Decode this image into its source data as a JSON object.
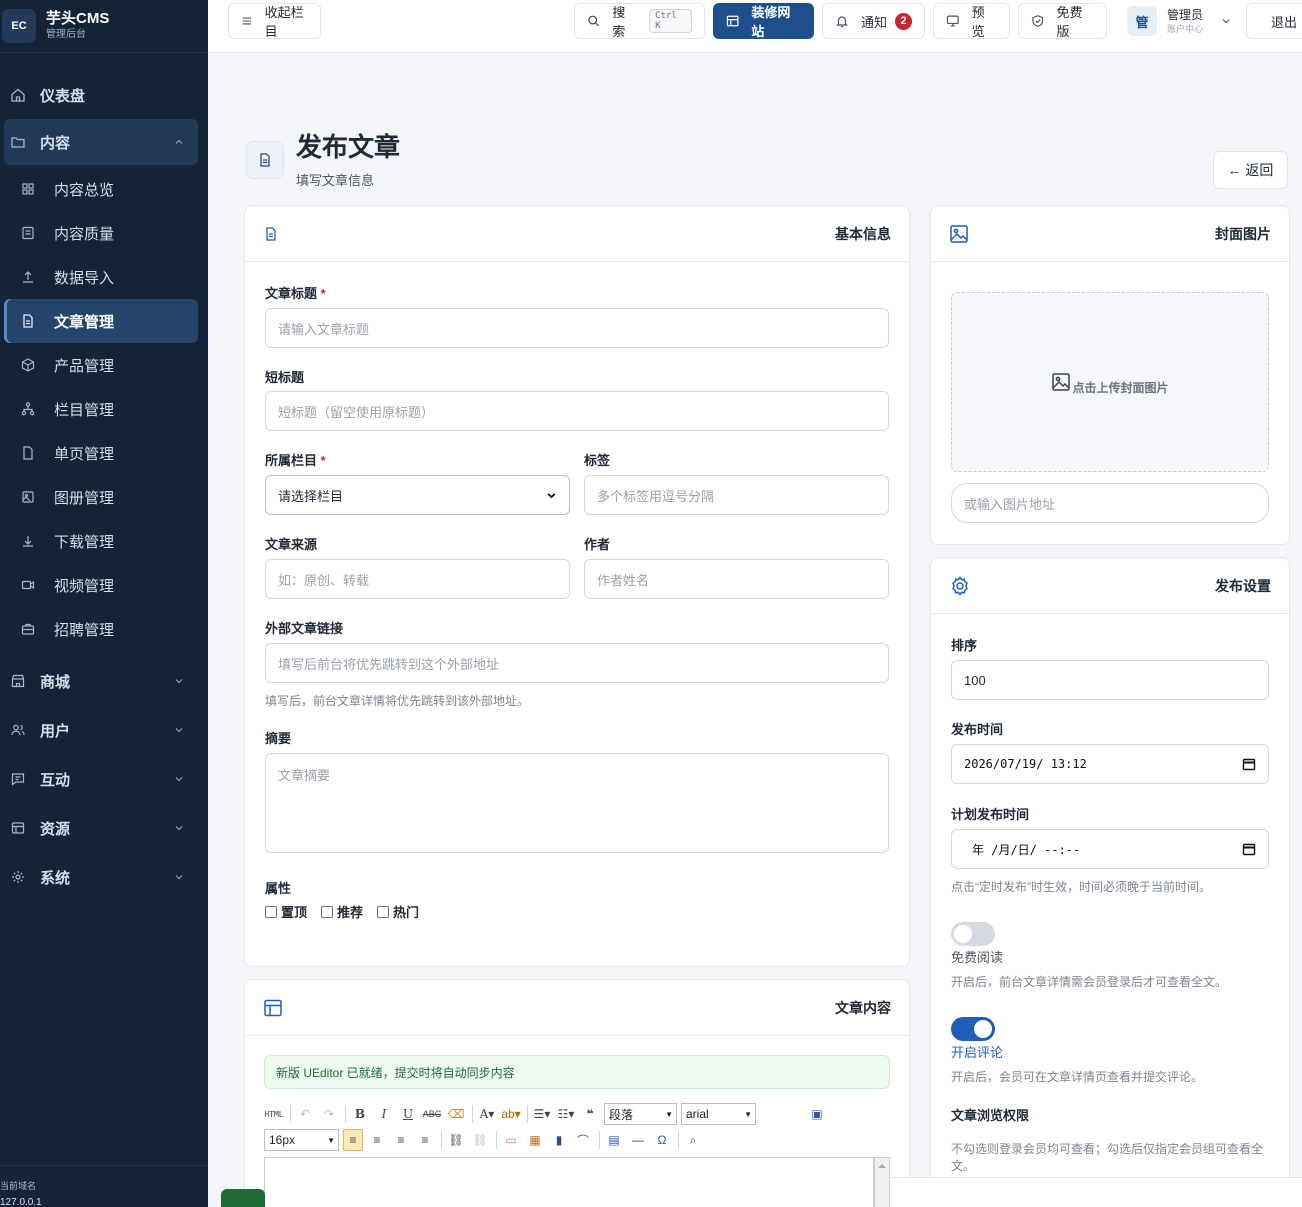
{
  "brand": {
    "logo": "EC",
    "name": "芋头CMS",
    "sub": "管理后台"
  },
  "sidebar": {
    "items": [
      {
        "label": "仪表盘",
        "icon": "home-icon"
      },
      {
        "label": "内容",
        "icon": "folder-icon"
      },
      {
        "label": "内容总览",
        "icon": "grid-icon"
      },
      {
        "label": "内容质量",
        "icon": "checklist-icon"
      },
      {
        "label": "数据导入",
        "icon": "upload-icon"
      },
      {
        "label": "文章管理",
        "icon": "document-icon"
      },
      {
        "label": "产品管理",
        "icon": "package-icon"
      },
      {
        "label": "栏目管理",
        "icon": "sitemap-icon"
      },
      {
        "label": "单页管理",
        "icon": "page-icon"
      },
      {
        "label": "图册管理",
        "icon": "album-icon"
      },
      {
        "label": "下载管理",
        "icon": "download-icon"
      },
      {
        "label": "视频管理",
        "icon": "video-icon"
      },
      {
        "label": "招聘管理",
        "icon": "briefcase-icon"
      },
      {
        "label": "商城",
        "icon": "store-icon"
      },
      {
        "label": "用户",
        "icon": "users-icon"
      },
      {
        "label": "互动",
        "icon": "chat-icon"
      },
      {
        "label": "资源",
        "icon": "layout-icon"
      },
      {
        "label": "系统",
        "icon": "settings-icon"
      }
    ],
    "footer_key": "当前域名",
    "footer_value": "127.0.0.1"
  },
  "topbar": {
    "collapse": "收起栏目",
    "search": "搜索",
    "search_kbd": "Ctrl K",
    "decorate": "装修网站",
    "notify": "通知",
    "notify_count": "2",
    "preview": "预览",
    "edition": "免费版",
    "avatar": "管",
    "user_name": "管理员",
    "user_role": "账户中心",
    "logout": "退出"
  },
  "page": {
    "title": "发布文章",
    "subtitle": "填写文章信息",
    "back": "← 返回"
  },
  "basic": {
    "heading": "基本信息",
    "title_label": "文章标题",
    "title_placeholder": "请输入文章标题",
    "short_label": "短标题",
    "short_placeholder": "短标题（留空使用原标题）",
    "column_label": "所属栏目",
    "column_value": "请选择栏目",
    "tags_label": "标签",
    "tags_placeholder": "多个标签用逗号分隔",
    "source_label": "文章来源",
    "source_placeholder": "如：原创、转载",
    "author_label": "作者",
    "author_placeholder": "作者姓名",
    "link_label": "外部文章链接",
    "link_placeholder": "填写后前台将优先跳转到这个外部地址",
    "link_hint": "填写后，前台文章详情将优先跳转到该外部地址。",
    "summary_label": "摘要",
    "summary_placeholder": "文章摘要",
    "attr_label": "属性",
    "attrs": [
      "置顶",
      "推荐",
      "热门"
    ],
    "required_mark": "*"
  },
  "content": {
    "heading": "文章内容",
    "notice": "新版 UEditor 已就绪，提交时将自动同步内容",
    "toolbar": {
      "html": "HTML",
      "paragraph": "段落",
      "font": "arial",
      "size": "16px"
    }
  },
  "cover": {
    "heading": "封面图片",
    "upload_text": "点击上传封面图片",
    "url_placeholder": "或输入图片地址"
  },
  "publish": {
    "heading": "发布设置",
    "sort_label": "排序",
    "sort_value": "100",
    "time_label": "发布时间",
    "time_value": "2026/07/19/  13:12",
    "schedule_label": "计划发布时间",
    "schedule_value": "年 /月/日/  --:--",
    "schedule_hint": "点击“定时发布”时生效，时间必须晚于当前时间。",
    "free_label": "免费阅读",
    "free_on": false,
    "free_hint": "开启后，前台文章详情需会员登录后才可查看全文。",
    "comment_label": "开启评论",
    "comment_on": true,
    "comment_hint": "开启后，会员可在文章详情页查看并提交评论。",
    "perm_label": "文章浏览权限",
    "perm_hint": "不勾选则登录会员均可查看；勾选后仅指定会员组可查看全文。"
  },
  "colors": {
    "sidebar": "#152336",
    "accent": "#1f4e8c",
    "danger": "#c2282e",
    "toggle_on": "#1f5fb8",
    "toggle_off": "#d5dae1"
  }
}
